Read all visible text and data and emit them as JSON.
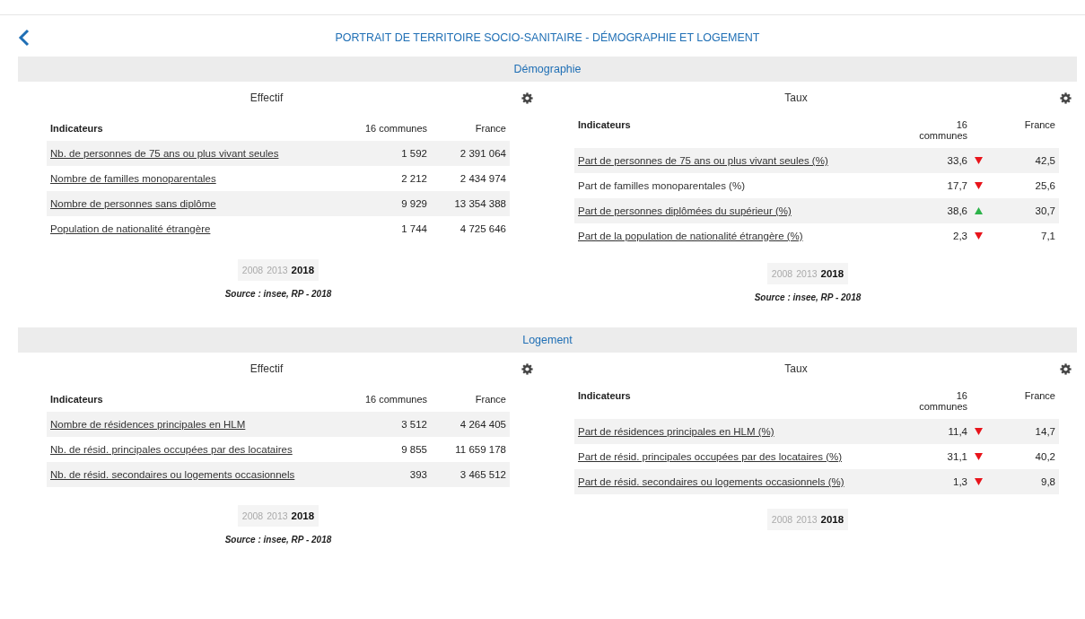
{
  "header": {
    "title": "PORTRAIT DE TERRITOIRE SOCIO-SANITAIRE - DÉMOGRAPHIE ET LOGEMENT"
  },
  "sections": [
    {
      "title": "Démographie",
      "panels": [
        {
          "kind": "count",
          "title": "Effectif",
          "columns": [
            "Indicateurs",
            "16 communes",
            "France"
          ],
          "rows": [
            {
              "label": "Nb. de personnes de 75 ans ou plus vivant seules",
              "link": true,
              "value": "1 592",
              "france": "2 391 064"
            },
            {
              "label": "Nombre de familles monoparentales",
              "link": true,
              "value": "2 212",
              "france": "2 434 974"
            },
            {
              "label": "Nombre de personnes sans diplôme",
              "link": true,
              "value": "9 929",
              "france": "13 354 388"
            },
            {
              "label": "Population de nationalité étrangère",
              "link": true,
              "value": "1 744",
              "france": "4 725 646"
            }
          ],
          "years": [
            {
              "label": "2008",
              "selected": false
            },
            {
              "label": "2013",
              "selected": false
            },
            {
              "label": "2018",
              "selected": true
            }
          ],
          "source": "Source : insee, RP - 2018"
        },
        {
          "kind": "rate",
          "title": "Taux",
          "columns": [
            "Indicateurs",
            "16 communes",
            "France"
          ],
          "rows": [
            {
              "label": "Part de personnes de 75 ans ou plus vivant seules (%)",
              "link": true,
              "value": "33,6",
              "kind": "down",
              "france": "42,5"
            },
            {
              "label": "Part de familles monoparentales (%)",
              "link": false,
              "value": "17,7",
              "kind": "down",
              "france": "25,6"
            },
            {
              "label": "Part de personnes diplômées du supérieur (%)",
              "link": true,
              "value": "38,6",
              "kind": "up",
              "france": "30,7"
            },
            {
              "label": "Part de la population de nationalité étrangère (%)",
              "link": true,
              "value": "2,3",
              "kind": "down",
              "france": "7,1"
            }
          ],
          "years": [
            {
              "label": "2008",
              "selected": false
            },
            {
              "label": "2013",
              "selected": false
            },
            {
              "label": "2018",
              "selected": true
            }
          ],
          "source": "Source : insee, RP - 2018"
        }
      ]
    },
    {
      "title": "Logement",
      "panels": [
        {
          "kind": "count",
          "title": "Effectif",
          "columns": [
            "Indicateurs",
            "16 communes",
            "France"
          ],
          "rows": [
            {
              "label": "Nombre de résidences principales en HLM",
              "link": true,
              "value": "3 512",
              "france": "4 264 405"
            },
            {
              "label": "Nb. de résid. principales occupées par des locataires",
              "link": true,
              "value": "9 855",
              "france": "11 659 178"
            },
            {
              "label": "Nb. de résid. secondaires ou logements occasionnels",
              "link": true,
              "value": "393",
              "france": "3 465 512"
            }
          ],
          "years": [
            {
              "label": "2008",
              "selected": false
            },
            {
              "label": "2013",
              "selected": false
            },
            {
              "label": "2018",
              "selected": true
            }
          ],
          "source": "Source : insee, RP - 2018"
        },
        {
          "kind": "rate",
          "title": "Taux",
          "columns": [
            "Indicateurs",
            "16 communes",
            "France"
          ],
          "rows": [
            {
              "label": "Part de résidences principales en HLM (%)",
              "link": true,
              "value": "11,4",
              "kind": "down",
              "france": "14,7"
            },
            {
              "label": "Part de résid. principales occupées par des locataires (%)",
              "link": true,
              "value": "31,1",
              "kind": "down",
              "france": "40,2"
            },
            {
              "label": "Part de résid. secondaires ou logements occasionnels (%)",
              "link": true,
              "value": "1,3",
              "kind": "down",
              "france": "9,8"
            }
          ],
          "years": [
            {
              "label": "2008",
              "selected": false
            },
            {
              "label": "2013",
              "selected": false
            },
            {
              "label": "2018",
              "selected": true
            }
          ]
        }
      ]
    }
  ]
}
